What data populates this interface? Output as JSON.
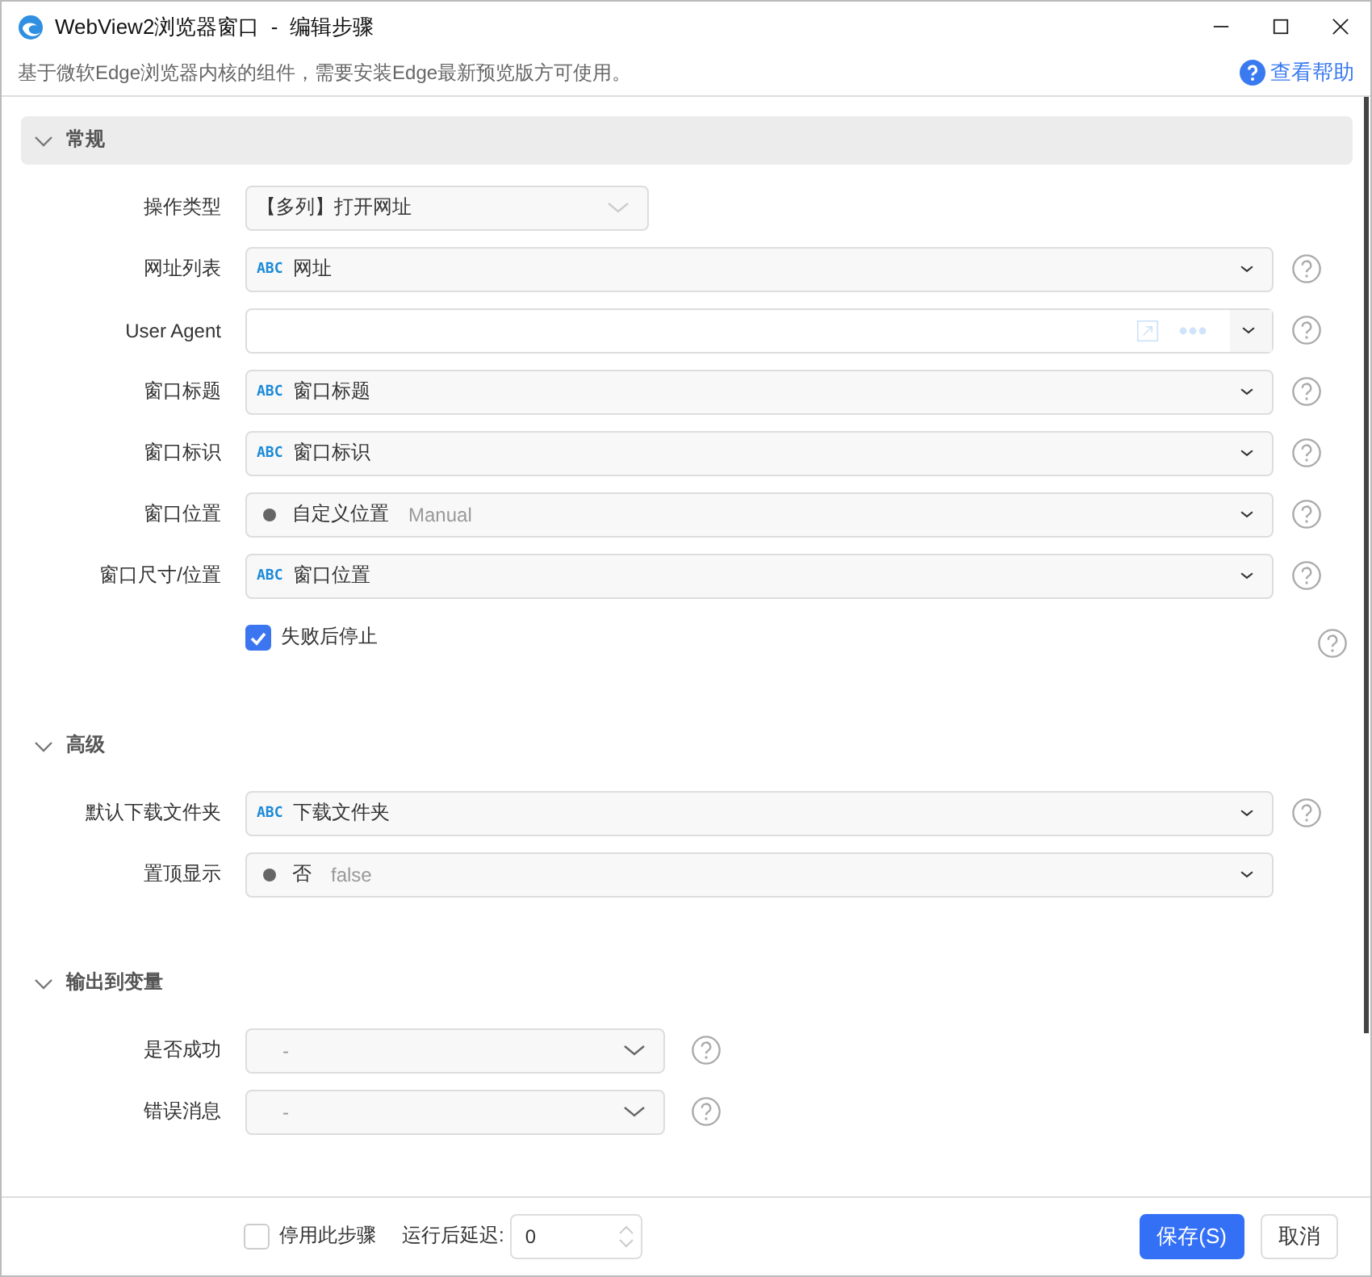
{
  "window": {
    "title": "WebView2浏览器窗口  -  编辑步骤"
  },
  "info_bar": {
    "text": "基于微软Edge浏览器内核的组件，需要安装Edge最新预览版方可使用。",
    "help_link": "查看帮助"
  },
  "sections": [
    {
      "title": "常规",
      "expanded": true,
      "highlighted": true,
      "rows": [
        {
          "kind": "select",
          "label": "操作类型",
          "value": "【多列】打开网址",
          "help": false
        },
        {
          "kind": "variable",
          "label": "网址列表",
          "tag": "ABC",
          "value": "网址",
          "help": true
        },
        {
          "kind": "text",
          "label": "User Agent",
          "help": true
        },
        {
          "kind": "variable",
          "label": "窗口标题",
          "tag": "ABC",
          "value": "窗口标题",
          "help": true
        },
        {
          "kind": "variable",
          "label": "窗口标识",
          "tag": "ABC",
          "value": "窗口标识",
          "help": true
        },
        {
          "kind": "enum",
          "label": "窗口位置",
          "value": "自定义位置",
          "hint": "Manual",
          "help": true
        },
        {
          "kind": "variable",
          "label": "窗口尺寸/位置",
          "tag": "ABC",
          "value": "窗口位置",
          "help": true
        },
        {
          "kind": "checkbox",
          "text": "失败后停止",
          "checked": true,
          "help": true
        }
      ]
    },
    {
      "title": "高级",
      "expanded": true,
      "highlighted": false,
      "rows": [
        {
          "kind": "variable",
          "label": "默认下载文件夹",
          "tag": "ABC",
          "value": "下载文件夹",
          "help": true
        },
        {
          "kind": "enum",
          "label": "置顶显示",
          "value": "否",
          "hint": "false",
          "help": false
        }
      ]
    },
    {
      "title": "输出到变量",
      "expanded": true,
      "highlighted": false,
      "rows": [
        {
          "kind": "output",
          "label": "是否成功",
          "value": "-",
          "help": true
        },
        {
          "kind": "output",
          "label": "错误消息",
          "value": "-",
          "help": true
        }
      ]
    }
  ],
  "footer": {
    "disable": {
      "label": "停用此步骤",
      "checked": false
    },
    "delay": {
      "label": "运行后延迟:",
      "value": "0"
    },
    "buttons": [
      {
        "label": "保存(S)",
        "primary": true
      },
      {
        "label": "取消",
        "primary": false
      }
    ]
  }
}
